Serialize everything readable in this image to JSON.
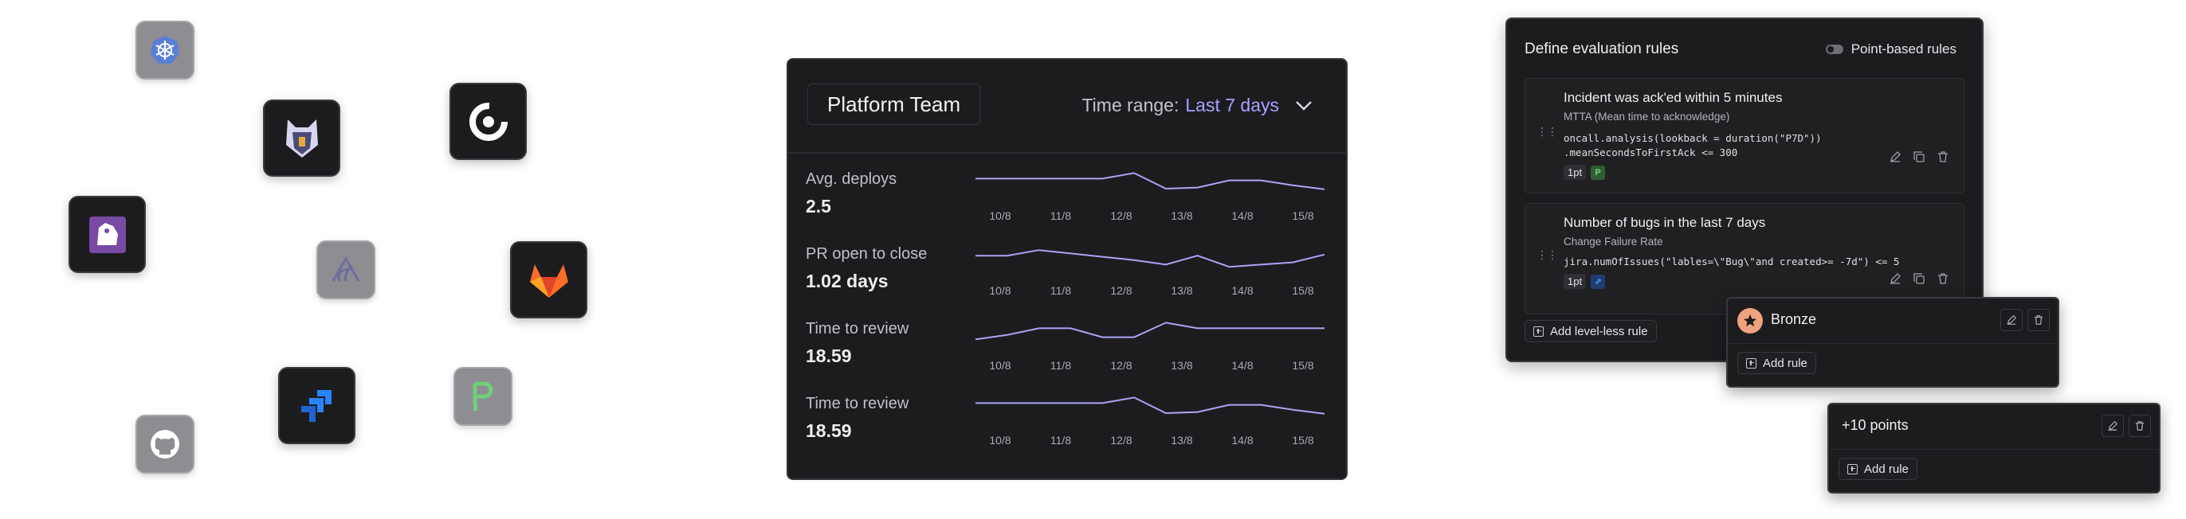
{
  "integrations": [
    {
      "name": "kubernetes-icon"
    },
    {
      "name": "snyk-icon"
    },
    {
      "name": "circleci-icon"
    },
    {
      "name": "datadog-icon"
    },
    {
      "name": "sentry-icon"
    },
    {
      "name": "gitlab-icon"
    },
    {
      "name": "jira-icon"
    },
    {
      "name": "pagerduty-icon"
    },
    {
      "name": "github-icon"
    }
  ],
  "metrics": {
    "team": "Platform Team",
    "time_range_label": "Time range:",
    "time_range_value": "Last 7 days",
    "ticks": [
      "10/8",
      "11/8",
      "12/8",
      "13/8",
      "14/8",
      "15/8"
    ],
    "rows": [
      {
        "label": "Avg. deploys",
        "value": "2.5",
        "points": [
          0.3,
          0.3,
          0.3,
          0.3,
          0.3,
          0.05,
          0.75,
          0.7,
          0.38,
          0.38,
          0.6,
          0.78
        ]
      },
      {
        "label": "PR open to close",
        "value": "1.02 days",
        "points": [
          0.4,
          0.4,
          0.15,
          0.3,
          0.45,
          0.6,
          0.8,
          0.4,
          0.9,
          0.8,
          0.7,
          0.35
        ]
      },
      {
        "label": "Time to review",
        "value": "18.59",
        "points": [
          0.8,
          0.6,
          0.3,
          0.3,
          0.7,
          0.7,
          0.05,
          0.3,
          0.3,
          0.3,
          0.3,
          0.3
        ]
      },
      {
        "label": "Time to review",
        "value": "18.59",
        "points": [
          0.3,
          0.3,
          0.3,
          0.3,
          0.3,
          0.05,
          0.75,
          0.7,
          0.38,
          0.38,
          0.6,
          0.78
        ]
      }
    ]
  },
  "rules": {
    "title": "Define evaluation rules",
    "toggle_label": "Point-based rules",
    "items": [
      {
        "title": "Incident was ack'ed within 5 minutes",
        "subtitle": "MTTA (Mean time to acknowledge)",
        "code": "oncall.analysis(lookback = duration(\"P7D\"))\n.meanSecondsToFirstAck <= 300",
        "points": "1pt",
        "source_icon": "pagerduty-icon"
      },
      {
        "title": "Number of bugs in the last 7 days",
        "subtitle": "Change Failure Rate",
        "code": "jira.numOfIssues(\"lables=\\\"Bug\\\"and created>= -7d\") <= 5",
        "points": "1pt",
        "source_icon": "jira-icon"
      }
    ],
    "add_levelless": "Add level-less rule"
  },
  "levels": [
    {
      "name": "Bronze",
      "add_rule": "Add rule"
    },
    {
      "name": "+10 points",
      "add_rule": "Add rule"
    }
  ],
  "colors": {
    "accent": "#a6a2ff",
    "line": "#a9a5f2",
    "bronze": "#f0a27e"
  }
}
